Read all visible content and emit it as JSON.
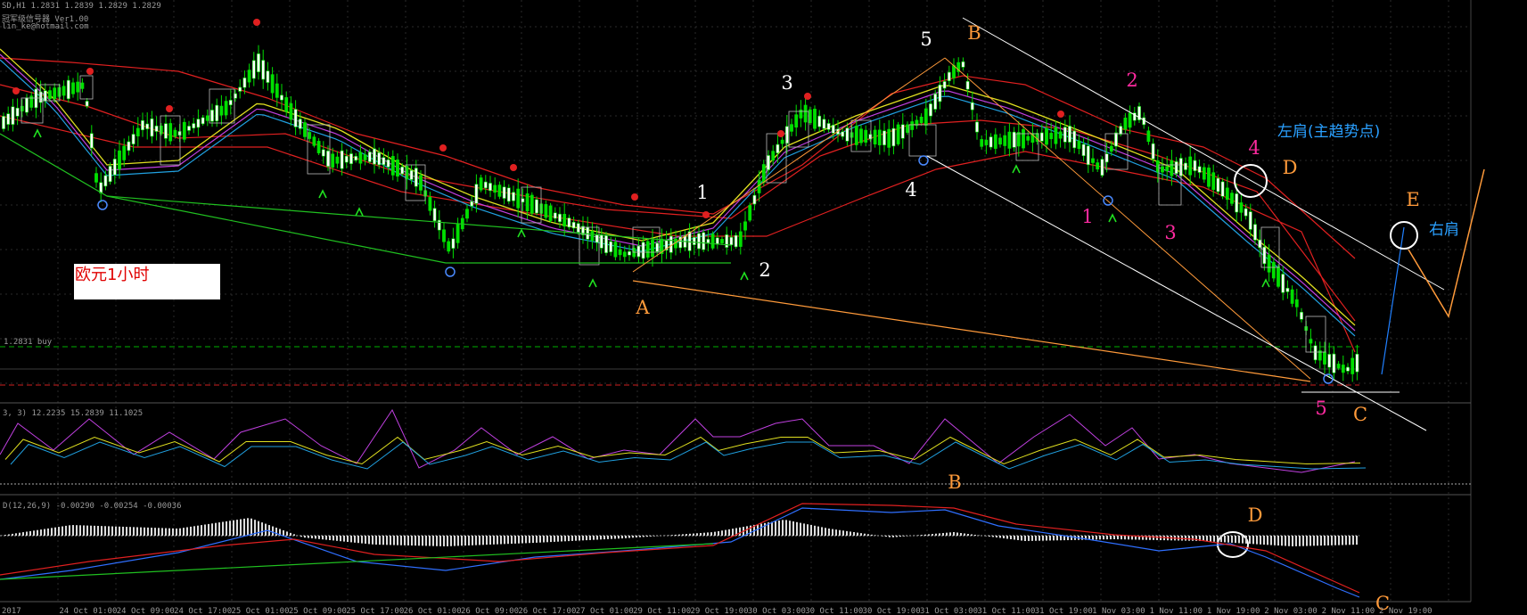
{
  "header": {
    "symbol_line": "SD,H1  1.2831  1.2839  1.2829  1.2829",
    "indicator_line": "冠军级信号器 Ver1.00",
    "contact_line": "lin_ke@hotmail.com"
  },
  "chart_data": {
    "type": "candlestick",
    "instrument": "EURUSD",
    "timeframe": "H1",
    "title": "欧元1小时",
    "time_labels": [
      "2017",
      "24 Oct 01:00",
      "24 Oct 09:00",
      "24 Oct 17:00",
      "25 Oct 01:00",
      "25 Oct 09:00",
      "25 Oct 17:00",
      "26 Oct 01:00",
      "26 Oct 09:00",
      "26 Oct 17:00",
      "27 Oct 01:00",
      "29 Oct 11:00",
      "29 Oct 19:00",
      "30 Oct 03:00",
      "30 Oct 11:00",
      "30 Oct 19:00",
      "31 Oct 03:00",
      "31 Oct 11:00",
      "31 Oct 19:00",
      "1 Nov 03:00",
      "1 Nov 11:00",
      "1 Nov 19:00",
      "2 Nov 03:00",
      "2 Nov 11:00",
      "2 Nov 19:00"
    ],
    "price_level_label": "1.2831 buy",
    "pattern_points": [
      {
        "label": "A",
        "color": "#ff9a3a"
      },
      {
        "label": "B",
        "color": "#ff9a3a"
      },
      {
        "label": "C",
        "color": "#ff9a3a"
      },
      {
        "label": "D",
        "color": "#ff9a3a"
      },
      {
        "label": "E",
        "color": "#ff9a3a"
      }
    ],
    "wave_up": [
      "1",
      "2",
      "3",
      "4",
      "5"
    ],
    "wave_down": [
      "1",
      "2",
      "3",
      "4",
      "5"
    ],
    "annotations": {
      "left_shoulder": "左肩(主趋势点)",
      "right_shoulder": "右肩"
    },
    "sub1": {
      "header": "3, 3)  12.2235  15.2839  11.1025",
      "series": [
        "purple",
        "yellow",
        "cyan"
      ]
    },
    "sub2": {
      "header": "D(12,26,9)  -0.00290  -0.00254  -0.00036",
      "marks": {
        "b": "B",
        "d": "D",
        "c": "C"
      }
    },
    "colors": {
      "bull": "#00e000",
      "bear": "#00e000",
      "ma_red": "#e02020",
      "ma_yellow": "#e0e020",
      "ma_cyan": "#20a0e0",
      "ma_purple": "#c040e0",
      "label_orange": "#ff9a3a",
      "label_pink": "#ff2aa0"
    }
  }
}
